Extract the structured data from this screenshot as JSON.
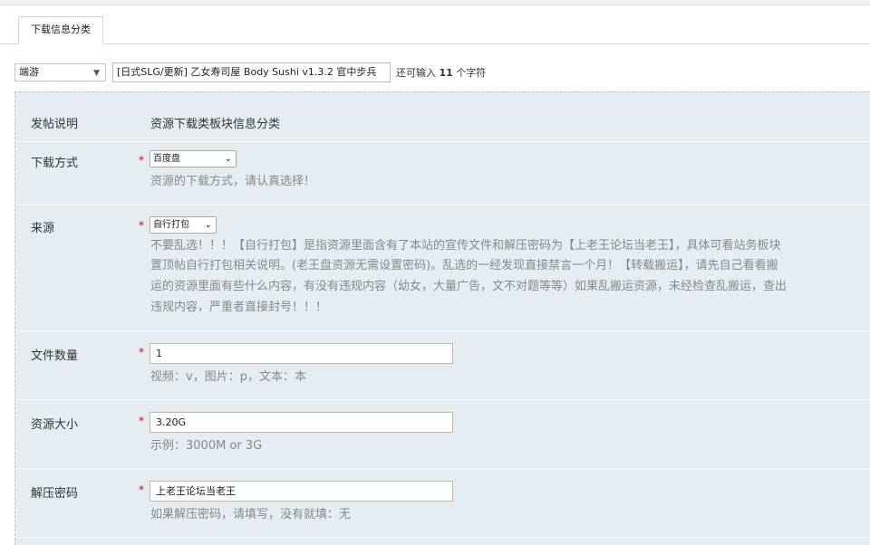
{
  "tab": {
    "label": "下载信息分类"
  },
  "title_row": {
    "type_select": "端游",
    "title_value": "[日式SLG/更新] 乙女寿司屋 Body Sushi v1.3.2 官中步兵",
    "hint_prefix": "还可输入",
    "hint_count": "11",
    "hint_suffix": "个字符"
  },
  "form": {
    "intro": {
      "label": "发帖说明",
      "value": "资源下载类板块信息分类"
    },
    "download_method": {
      "label": "下载方式",
      "required": "*",
      "selected": "百度盘",
      "desc": "资源的下载方式，请认真选择！"
    },
    "source": {
      "label": "来源",
      "required": "*",
      "selected": "自行打包",
      "desc_lines": [
        "不要乱选！！！【自行打包】是指资源里面含有了本站的宣传文件和解压密码为【上老王论坛当老王】，具体可看站务板块",
        "置顶帖自行打包相关说明。(老王盘资源无需设置密码)。乱选的一经发现直接禁言一个月！【转载搬运】，请先自己看看搬",
        "运的资源里面有些什么内容，有没有违规内容（幼女，大量广告，文不对题等等）如果乱搬运资源，未经检查乱搬运，查出",
        "违规内容，严重者直接封号！！！"
      ]
    },
    "file_count": {
      "label": "文件数量",
      "required": "*",
      "value": "1",
      "desc": "视频：v，图片：p，文本：本"
    },
    "size": {
      "label": "资源大小",
      "required": "*",
      "value": "3.20G",
      "desc": "示例：3000M or 3G"
    },
    "password": {
      "label": "解压密码",
      "required": "*",
      "value": "上老王论坛当老王",
      "desc": "如果解压密码，请填写，没有就填：无"
    }
  }
}
